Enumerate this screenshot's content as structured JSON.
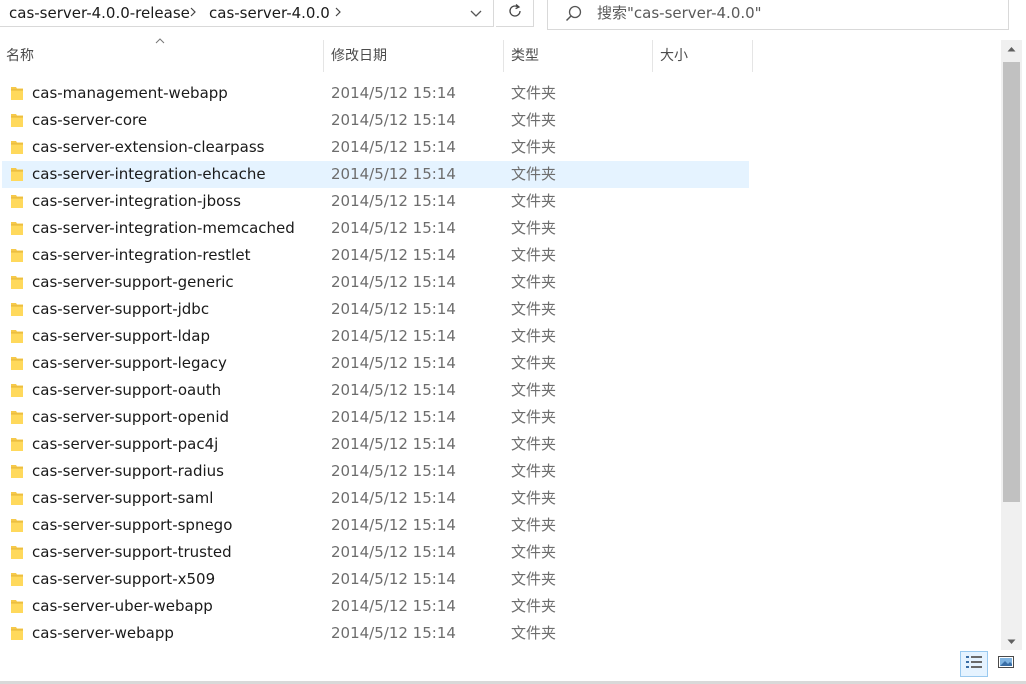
{
  "address": {
    "crumbs": [
      "cas-server-4.0.0-release",
      "cas-server-4.0.0"
    ],
    "separator_icon": "chevron-right-icon",
    "dropdown_icon": "chevron-down-icon",
    "refresh_icon": "refresh-icon"
  },
  "search": {
    "placeholder": "搜索\"cas-server-4.0.0\"",
    "icon": "search-icon"
  },
  "columns": {
    "name": "名称",
    "modified": "修改日期",
    "type": "类型",
    "size": "大小"
  },
  "colors": {
    "selected_row": "#e5f3ff",
    "folder": "#f6c94a",
    "secondary_text": "#6d6d6d"
  },
  "files": [
    {
      "name": "cas-management-webapp",
      "modified": "2014/5/12 15:14",
      "type": "文件夹"
    },
    {
      "name": "cas-server-core",
      "modified": "2014/5/12 15:14",
      "type": "文件夹"
    },
    {
      "name": "cas-server-extension-clearpass",
      "modified": "2014/5/12 15:14",
      "type": "文件夹"
    },
    {
      "name": "cas-server-integration-ehcache",
      "modified": "2014/5/12 15:14",
      "type": "文件夹",
      "selected": true
    },
    {
      "name": "cas-server-integration-jboss",
      "modified": "2014/5/12 15:14",
      "type": "文件夹"
    },
    {
      "name": "cas-server-integration-memcached",
      "modified": "2014/5/12 15:14",
      "type": "文件夹"
    },
    {
      "name": "cas-server-integration-restlet",
      "modified": "2014/5/12 15:14",
      "type": "文件夹"
    },
    {
      "name": "cas-server-support-generic",
      "modified": "2014/5/12 15:14",
      "type": "文件夹"
    },
    {
      "name": "cas-server-support-jdbc",
      "modified": "2014/5/12 15:14",
      "type": "文件夹"
    },
    {
      "name": "cas-server-support-ldap",
      "modified": "2014/5/12 15:14",
      "type": "文件夹"
    },
    {
      "name": "cas-server-support-legacy",
      "modified": "2014/5/12 15:14",
      "type": "文件夹"
    },
    {
      "name": "cas-server-support-oauth",
      "modified": "2014/5/12 15:14",
      "type": "文件夹"
    },
    {
      "name": "cas-server-support-openid",
      "modified": "2014/5/12 15:14",
      "type": "文件夹"
    },
    {
      "name": "cas-server-support-pac4j",
      "modified": "2014/5/12 15:14",
      "type": "文件夹"
    },
    {
      "name": "cas-server-support-radius",
      "modified": "2014/5/12 15:14",
      "type": "文件夹"
    },
    {
      "name": "cas-server-support-saml",
      "modified": "2014/5/12 15:14",
      "type": "文件夹"
    },
    {
      "name": "cas-server-support-spnego",
      "modified": "2014/5/12 15:14",
      "type": "文件夹"
    },
    {
      "name": "cas-server-support-trusted",
      "modified": "2014/5/12 15:14",
      "type": "文件夹"
    },
    {
      "name": "cas-server-support-x509",
      "modified": "2014/5/12 15:14",
      "type": "文件夹"
    },
    {
      "name": "cas-server-uber-webapp",
      "modified": "2014/5/12 15:14",
      "type": "文件夹"
    },
    {
      "name": "cas-server-webapp",
      "modified": "2014/5/12 15:14",
      "type": "文件夹"
    }
  ],
  "view": {
    "details_icon": "details-view-icon",
    "large_icons_icon": "large-icons-view-icon",
    "active": "details"
  }
}
